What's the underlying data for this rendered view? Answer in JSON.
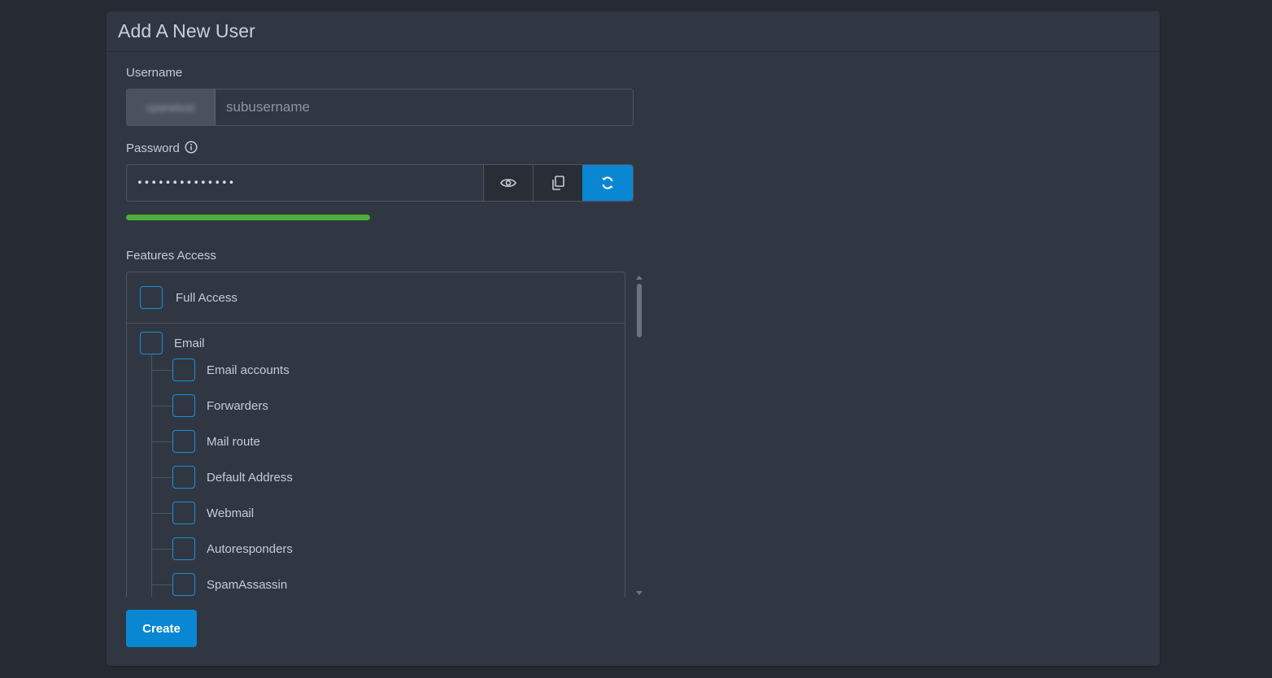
{
  "panel": {
    "title": "Add A New User"
  },
  "username": {
    "label": "Username",
    "prefix_value": "cpanelusr",
    "placeholder": "subusername",
    "value": ""
  },
  "password": {
    "label": "Password",
    "value": "••••••••••••••",
    "strength_percent": 48,
    "buttons": {
      "show": "eye-icon",
      "copy": "copy-icon",
      "generate": "refresh-icon"
    }
  },
  "features": {
    "label": "Features Access",
    "full_access": "Full Access",
    "group_email": "Email",
    "email_items": [
      "Email accounts",
      "Forwarders",
      "Mail route",
      "Default Address",
      "Webmail",
      "Autoresponders",
      "SpamAssassin"
    ]
  },
  "actions": {
    "create": "Create"
  },
  "colors": {
    "accent": "#0a87d2",
    "strength": "#4caf38",
    "panel_bg": "#313742",
    "page_bg": "#262a33"
  }
}
